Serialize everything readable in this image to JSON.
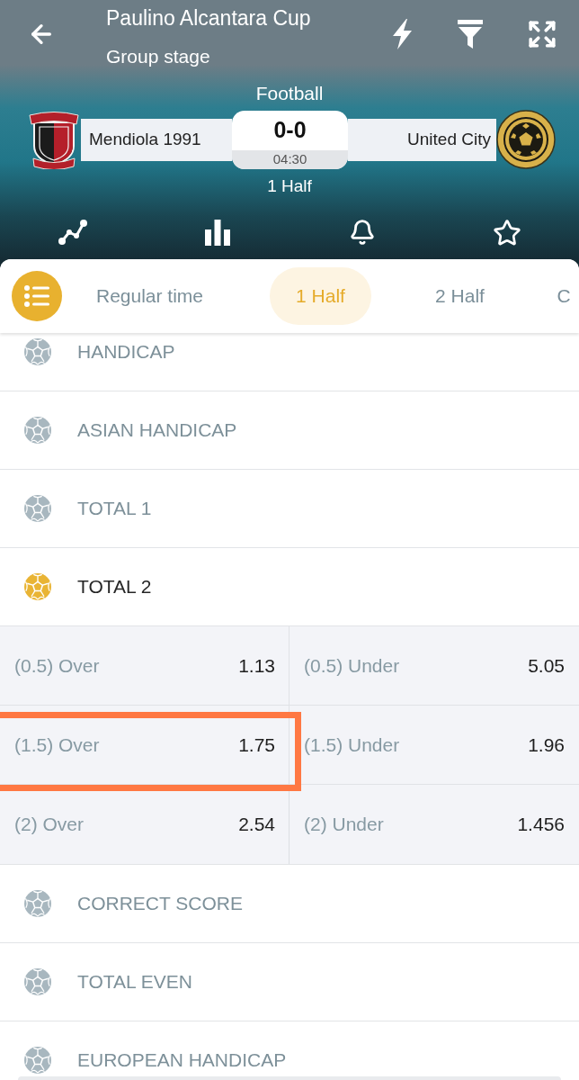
{
  "header": {
    "title": "Paulino Alcantara Cup",
    "subtitle": "Group stage",
    "sport": "Football"
  },
  "match": {
    "home": {
      "name": "Mendiola 1991"
    },
    "away": {
      "name": "United City"
    },
    "score": "0-0",
    "clock": "04:30",
    "period": "1 Half"
  },
  "period_tabs": [
    {
      "label": "Regular time",
      "selected": false
    },
    {
      "label": "1 Half",
      "selected": true
    },
    {
      "label": "2 Half",
      "selected": false
    },
    {
      "label": "C",
      "selected": false
    }
  ],
  "markets": [
    {
      "name": "HANDICAP",
      "expanded": false
    },
    {
      "name": "ASIAN HANDICAP",
      "expanded": false
    },
    {
      "name": "TOTAL 1",
      "expanded": false
    },
    {
      "name": "TOTAL 2",
      "expanded": true,
      "outcome_rows": [
        {
          "cells": [
            {
              "label": "(0.5) Over",
              "odds": "1.13",
              "highlighted": false
            },
            {
              "label": "(0.5) Under",
              "odds": "5.05",
              "highlighted": false
            }
          ]
        },
        {
          "cells": [
            {
              "label": "(1.5) Over",
              "odds": "1.75",
              "highlighted": true
            },
            {
              "label": "(1.5) Under",
              "odds": "1.96",
              "highlighted": false
            }
          ]
        },
        {
          "cells": [
            {
              "label": "(2) Over",
              "odds": "2.54",
              "highlighted": false
            },
            {
              "label": "(2) Under",
              "odds": "1.456",
              "highlighted": false
            }
          ]
        }
      ]
    },
    {
      "name": "CORRECT SCORE",
      "expanded": false
    },
    {
      "name": "TOTAL EVEN",
      "expanded": false
    },
    {
      "name": "EUROPEAN HANDICAP",
      "expanded": false
    }
  ]
}
